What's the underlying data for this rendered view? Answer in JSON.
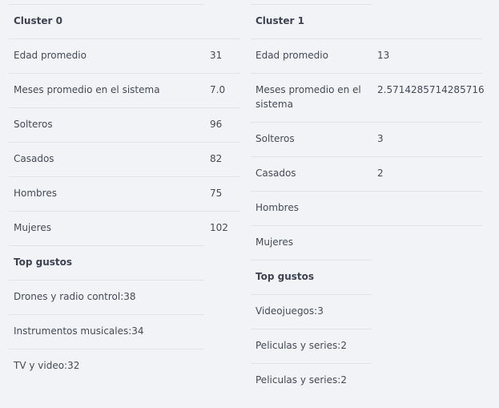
{
  "cluster0": {
    "title": "Cluster 0",
    "edad_label": "Edad promedio",
    "edad_value": "31",
    "meses_label": "Meses promedio en el sistema",
    "meses_value": "7.0",
    "solteros_label": "Solteros",
    "solteros_value": "96",
    "casados_label": "Casados",
    "casados_value": "82",
    "hombres_label": "Hombres",
    "hombres_value": "75",
    "mujeres_label": "Mujeres",
    "mujeres_value": "102",
    "gustos_title": "Top gustos",
    "gustos": [
      "Drones y radio control:38",
      "Instrumentos musicales:34",
      "TV y video:32"
    ]
  },
  "cluster1": {
    "title": "Cluster 1",
    "edad_label": "Edad promedio",
    "edad_value": "13",
    "meses_label": "Meses promedio en el sistema",
    "meses_value": "2.5714285714285716",
    "solteros_label": "Solteros",
    "solteros_value": "3",
    "casados_label": "Casados",
    "casados_value": "2",
    "hombres_label": "Hombres",
    "mujeres_label": "Mujeres",
    "gustos_title": "Top gustos",
    "gustos": [
      "Videojuegos:3",
      "Peliculas y series:2",
      "Peliculas y series:2"
    ]
  }
}
